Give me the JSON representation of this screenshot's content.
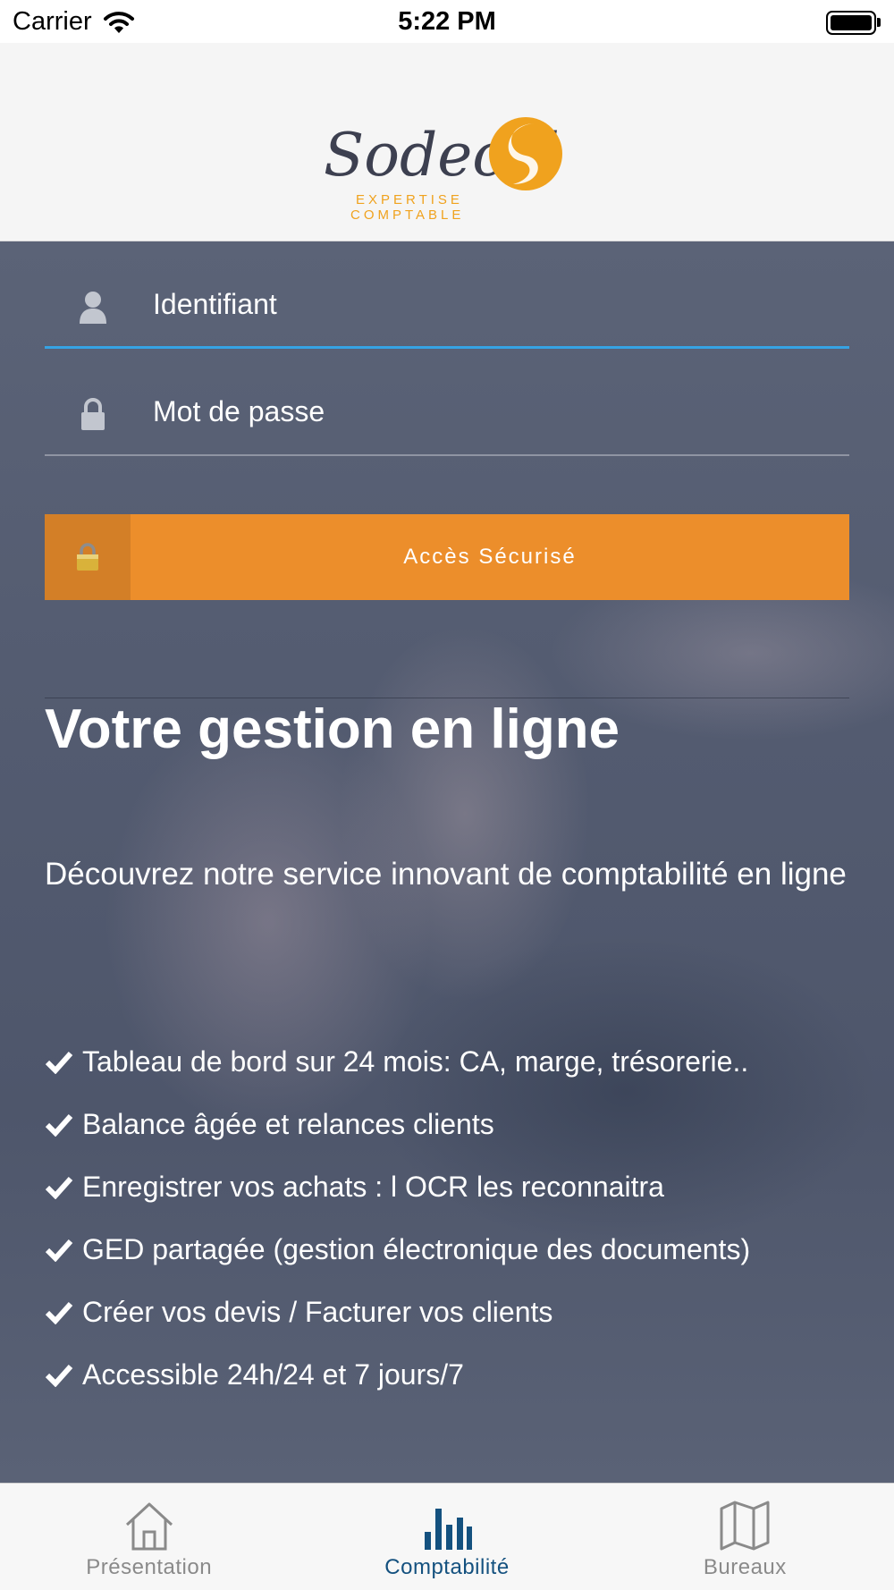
{
  "status_bar": {
    "carrier": "Carrier",
    "time": "5:22 PM"
  },
  "logo": {
    "wordmark": "Sodecal",
    "tagline_line1": "EXPERTISE",
    "tagline_line2": "COMPTABLE"
  },
  "login": {
    "username_placeholder": "Identifiant",
    "password_placeholder": "Mot de passe",
    "secure_button_label": "Accès Sécurisé"
  },
  "content": {
    "headline": "Votre gestion en ligne",
    "intro": "Découvrez notre service innovant de comptabilité en ligne",
    "features": [
      "Tableau de bord sur 24 mois: CA, marge, trésorerie..",
      "Balance âgée et relances clients",
      "Enregistrer vos achats : l OCR les reconnaitra",
      "GED partagée (gestion électronique des documents)",
      "Créer vos devis / Facturer vos clients",
      "Accessible 24h/24 et 7 jours/7"
    ]
  },
  "tab_bar": {
    "tabs": [
      {
        "label": "Présentation",
        "icon": "home-icon",
        "active": false
      },
      {
        "label": "Comptabilité",
        "icon": "bar-chart-icon",
        "active": true
      },
      {
        "label": "Bureaux",
        "icon": "map-icon",
        "active": false
      }
    ]
  },
  "colors": {
    "accent_orange": "#ec8e2b",
    "focus_blue": "#36a3e3",
    "active_tab": "#14517f",
    "inactive_tab": "#8a8a8a"
  }
}
